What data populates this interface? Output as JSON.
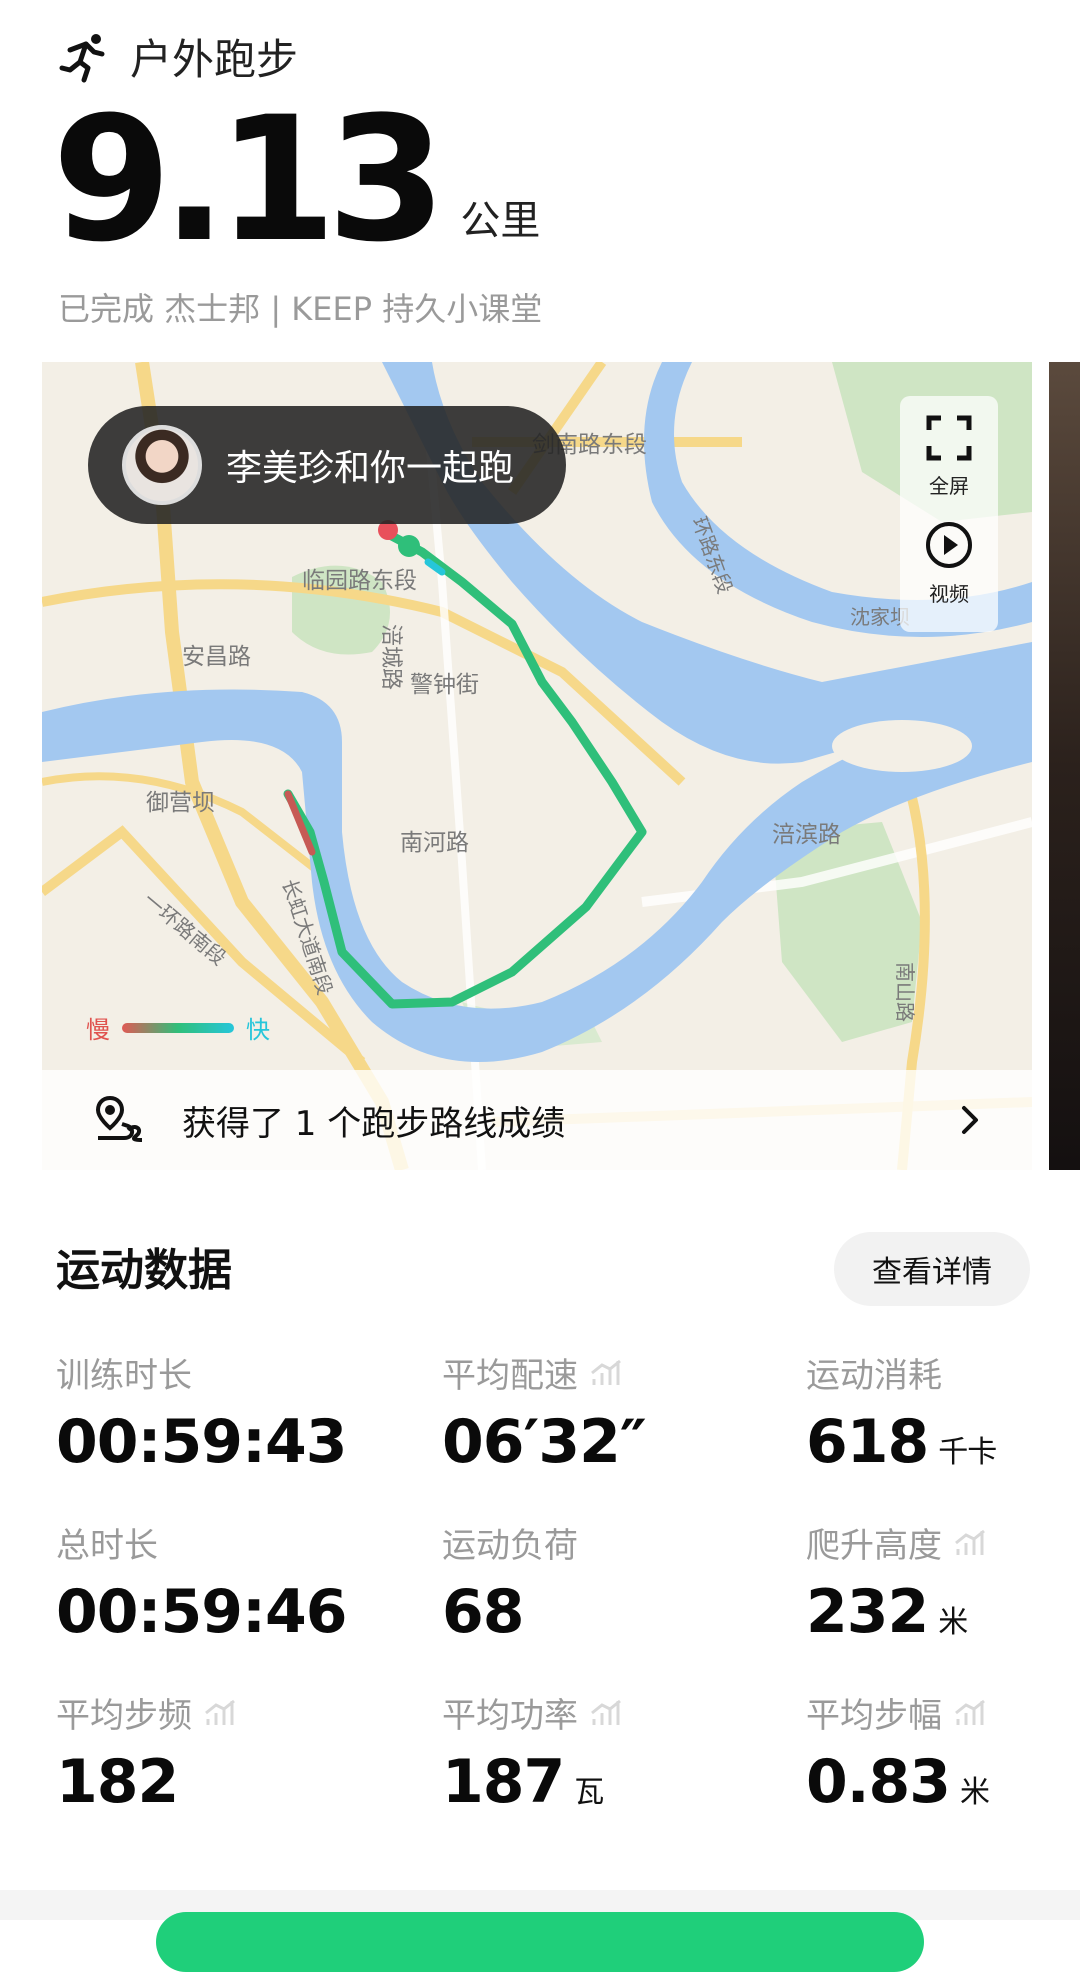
{
  "header": {
    "activity_type": "户外跑步",
    "distance_value": "9.13",
    "distance_unit": "公里",
    "completed_text": "已完成 杰士邦 | KEEP 持久小课堂"
  },
  "map": {
    "companion_text": "李美珍和你一起跑",
    "fullscreen_label": "全屏",
    "video_label": "视频",
    "legend_slow": "慢",
    "legend_fast": "快",
    "streets": [
      "剑南路东段",
      "临园路东段",
      "安昌路",
      "涪城路",
      "警钟街",
      "御营坝",
      "南河路",
      "长虹大道南段",
      "一环路南段",
      "环路东段",
      "涪滨路",
      "南山路",
      "沈家坝"
    ],
    "route_banner_text": "获得了 1 个跑步路线成绩",
    "colors": {
      "route": "#2fbf7a",
      "water": "#a3c8f0",
      "road": "#f6d889",
      "green": "#cfe5c4"
    }
  },
  "stats": {
    "title": "运动数据",
    "details_label": "查看详情",
    "items": [
      {
        "label": "训练时长",
        "value": "00:59:43",
        "unit": ""
      },
      {
        "label": "平均配速",
        "value": "06′32″",
        "unit": ""
      },
      {
        "label": "运动消耗",
        "value": "618",
        "unit": "千卡"
      },
      {
        "label": "总时长",
        "value": "00:59:46",
        "unit": ""
      },
      {
        "label": "运动负荷",
        "value": "68",
        "unit": ""
      },
      {
        "label": "爬升高度",
        "value": "232",
        "unit": "米"
      },
      {
        "label": "平均步频",
        "value": "182",
        "unit": ""
      },
      {
        "label": "平均功率",
        "value": "187",
        "unit": "瓦"
      },
      {
        "label": "平均步幅",
        "value": "0.83",
        "unit": "米"
      }
    ]
  }
}
